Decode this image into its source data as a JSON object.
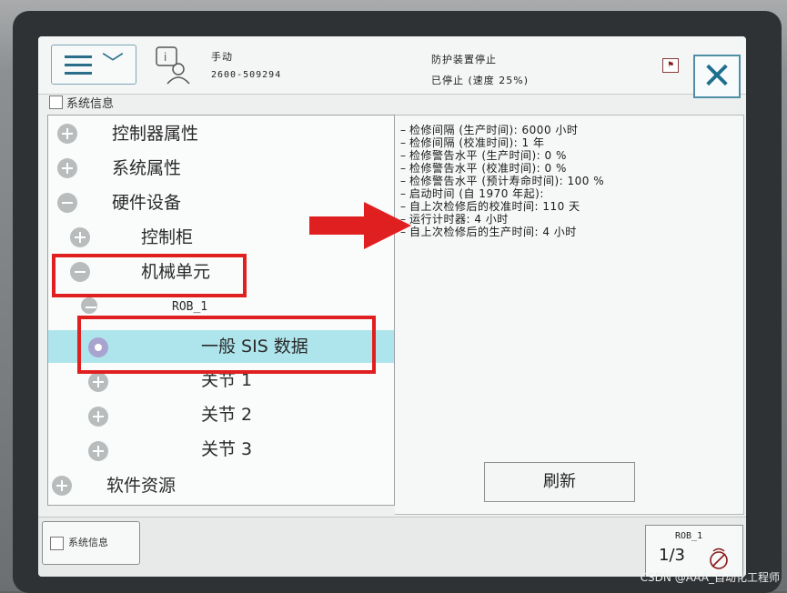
{
  "topbar": {
    "mode": "手动",
    "serial": "2600-509294",
    "status_line1": "防护装置停止",
    "status_line2": "已停止 (速度 25%)"
  },
  "tab": {
    "label": "系统信息"
  },
  "tree": {
    "items": [
      {
        "label": "控制器属性"
      },
      {
        "label": "系统属性"
      },
      {
        "label": "硬件设备"
      },
      {
        "label": "控制柜"
      },
      {
        "label": "机械单元"
      },
      {
        "label": "ROB_1"
      },
      {
        "label": "一般 SIS 数据"
      },
      {
        "label": "关节 1"
      },
      {
        "label": "关节 2"
      },
      {
        "label": "关节 3"
      },
      {
        "label": "软件资源"
      }
    ]
  },
  "info": {
    "lines": [
      "检修间隔 (生产时间): 6000 小时",
      "检修间隔 (校准时间): 1 年",
      "检修警告水平 (生产时间): 0 %",
      "检修警告水平 (校准时间): 0 %",
      "检修警告水平 (预计寿命时间): 100 %",
      "启动时间 (自 1970 年起):",
      "自上次检修后的校准时间: 110 天",
      "运行计时器: 4 小时",
      "自上次检修后的生产时间: 4 小时"
    ],
    "refresh_label": "刷新"
  },
  "bottom": {
    "task_label": "系统信息",
    "rob_label": "ROB_1",
    "rob_fraction": "1/3"
  },
  "watermark": "CSDN @AAA_自动化工程师",
  "colors": {
    "accent": "#1e6f8e",
    "selection": "#aee5ec",
    "callout": "#e02020"
  }
}
